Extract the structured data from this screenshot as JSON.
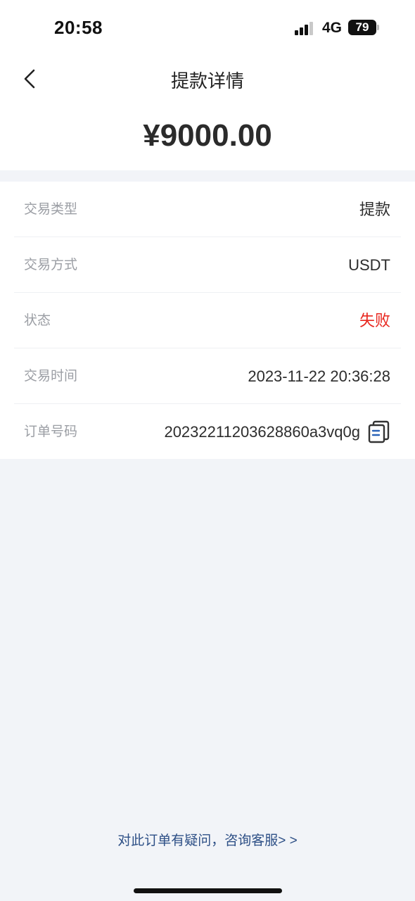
{
  "status_bar": {
    "time": "20:58",
    "network": "4G",
    "battery": "79"
  },
  "header": {
    "title": "提款详情",
    "amount": "¥9000.00"
  },
  "details": [
    {
      "label": "交易类型",
      "value": "提款"
    },
    {
      "label": "交易方式",
      "value": "USDT"
    },
    {
      "label": "状态",
      "value": "失败",
      "value_color": "#e8261e"
    },
    {
      "label": "交易时间",
      "value": "2023-11-22 20:36:28"
    },
    {
      "label": "订单号码",
      "value": "20232211203628860a3vq0g"
    }
  ],
  "footer": {
    "help_text": "对此订单有疑问，咨询客服> >"
  }
}
